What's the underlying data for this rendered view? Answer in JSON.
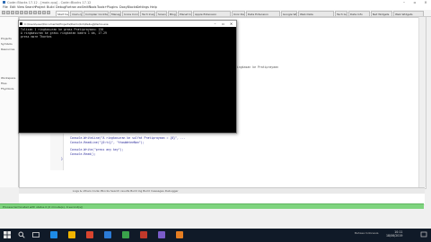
{
  "ide": {
    "title": "Code::Blocks 17.12 - [main.cpp] - Code::Blocks 17.12",
    "menu": [
      "File",
      "Edit",
      "View",
      "Search",
      "Project",
      "Build",
      "Debug",
      "Fortran",
      "wxSmith",
      "Tools",
      "Tools+",
      "Plugins",
      "DoxyBlocks",
      "Settings",
      "Help"
    ],
    "tabs": [
      "Start here",
      "main.cpp",
      "Compiler Cocktail",
      "Manage",
      "Ionos Connect",
      "Tech Insight",
      "Science",
      "Blog",
      "Planet Insight",
      "Apple Extension",
      "Unix Data",
      "Data Extension",
      "Google Widgets",
      "Web Data",
      "Tech Guide",
      "Data Info",
      "Net Widgets",
      "Web Widgets"
    ],
    "left_panel": [
      "Projects",
      "Symbols",
      "Resources",
      "Workspace",
      "Files",
      "FSymbols"
    ],
    "editor_code": [
      "Console.WriteLine(\"A ringkasuran ke sulfat Pratiprayaan = {0}\", ...",
      "Console.ReadLine(\"{0:ti}\", \"thouWateeNan\");",
      "Console.Write(\"press any key\");",
      "Console.Read();",
      "}"
    ],
    "editor_annotation": "ringkasan ke Pratiprayaan",
    "messages_bar": "Logs & others  Code::Blocks  Search results  Build log  Build messages  Debugger",
    "status_text": "Process terminated with status 0 (0 minute(s), 0 second(s))"
  },
  "console": {
    "title": "C:\\Users\\user\\Documents\\Projects\\Demo\\bin\\Debug\\Demo.exe",
    "lines": [
      "Tulisan 1 ringkasuran ke grass Pratiprayaan= 130",
      "A ringkasuran ke grass ringkatan kadra 1 da, 17.29",
      "press more Thorkes"
    ],
    "close": "✕"
  },
  "taskbar": {
    "icon_colors": [
      "#1e8be6",
      "#f0b400",
      "#d9452f",
      "#2b7bd6",
      "#3aa34b",
      "#c0392b",
      "#7a5cc9",
      "#e67e22"
    ],
    "notify_text": "Bahasa Indonesia",
    "time": "10:11",
    "date": "18/06/2019"
  },
  "colors": {
    "status_green": "#7ed47e",
    "console_bg": "#000000",
    "taskbar_bg": "#101a28"
  }
}
